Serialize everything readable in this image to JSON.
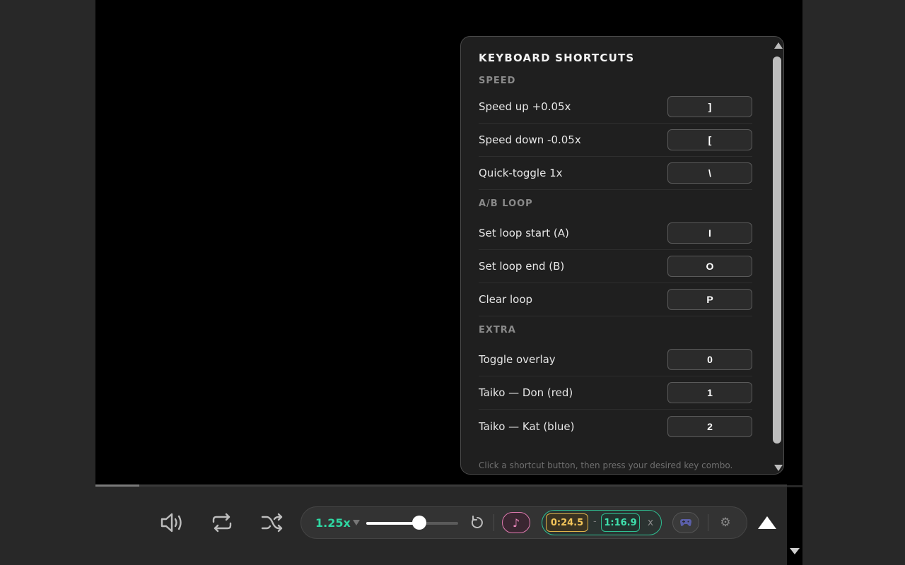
{
  "panel": {
    "title": "KEYBOARD SHORTCUTS",
    "hint": "Click a shortcut button, then press your desired key combo.",
    "sections": [
      {
        "heading": "SPEED",
        "rows": [
          {
            "label": "Speed up +0.05x",
            "key": "]"
          },
          {
            "label": "Speed down -0.05x",
            "key": "["
          },
          {
            "label": "Quick-toggle 1x",
            "key": "\\"
          }
        ]
      },
      {
        "heading": "A/B LOOP",
        "rows": [
          {
            "label": "Set loop start (A)",
            "key": "I"
          },
          {
            "label": "Set loop end (B)",
            "key": "O"
          },
          {
            "label": "Clear loop",
            "key": "P"
          }
        ]
      },
      {
        "heading": "EXTRA",
        "rows": [
          {
            "label": "Toggle overlay",
            "key": "0"
          },
          {
            "label": "Taiko — Don (red)",
            "key": "1"
          },
          {
            "label": "Taiko — Kat (blue)",
            "key": "2"
          }
        ]
      }
    ]
  },
  "controls": {
    "speed_label": "1.25x",
    "speed_slider_fraction": 0.58,
    "note_icon": "♪",
    "loop": {
      "start": "0:24.5",
      "separator": "-",
      "end": "1:16.9",
      "clear": "x"
    },
    "gear_icon": "⚙"
  },
  "progress_fraction": 0.063,
  "colors": {
    "accent_green": "#2fd7a2",
    "loop_start": "#f2c55a",
    "loop_end": "#3fe0ad",
    "note_pink": "#f08ac0"
  },
  "icons": [
    "volume-icon",
    "repeat-icon",
    "shuffle-icon",
    "reset-speed-icon",
    "music-note-icon",
    "gamepad-icon",
    "gear-icon",
    "collapse-up-icon"
  ]
}
